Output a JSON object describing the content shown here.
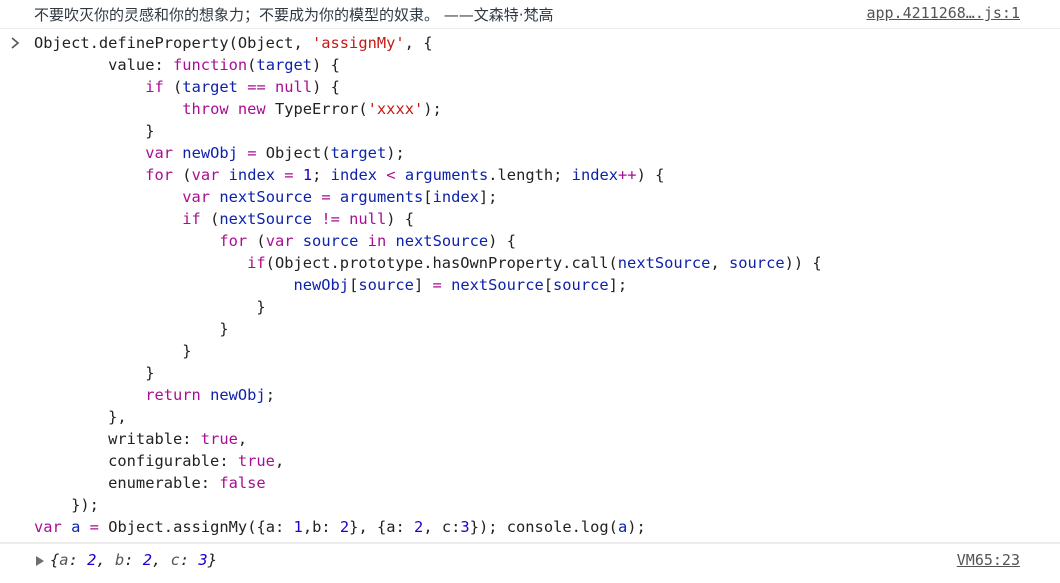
{
  "console_message": {
    "text": "不要吹灭你的灵感和你的想象力；不要成为你的模型的奴隶。 ——文森特·梵高",
    "source": "app.4211268….js:1"
  },
  "input_prompt_icon": "chevron-right-icon",
  "code_lines": [
    [
      [
        "pl",
        "Object.defineProperty(Object, "
      ],
      [
        "str",
        "'assignMy'"
      ],
      [
        "pl",
        ", {"
      ]
    ],
    [
      [
        "pl",
        "        value: "
      ],
      [
        "kw",
        "function"
      ],
      [
        "pl",
        "("
      ],
      [
        "var",
        "target"
      ],
      [
        "pl",
        ") {"
      ]
    ],
    [
      [
        "pl",
        "            "
      ],
      [
        "kw",
        "if"
      ],
      [
        "pl",
        " ("
      ],
      [
        "var",
        "target"
      ],
      [
        "pl",
        " "
      ],
      [
        "kw",
        "=="
      ],
      [
        "pl",
        " "
      ],
      [
        "kw",
        "null"
      ],
      [
        "pl",
        ") {"
      ]
    ],
    [
      [
        "pl",
        "                "
      ],
      [
        "kw",
        "throw"
      ],
      [
        "pl",
        " "
      ],
      [
        "kw",
        "new"
      ],
      [
        "pl",
        " TypeError("
      ],
      [
        "str",
        "'xxxx'"
      ],
      [
        "pl",
        ");"
      ]
    ],
    [
      [
        "pl",
        "            }"
      ]
    ],
    [
      [
        "pl",
        "            "
      ],
      [
        "kw",
        "var"
      ],
      [
        "pl",
        " "
      ],
      [
        "var",
        "newObj"
      ],
      [
        "pl",
        " "
      ],
      [
        "kw",
        "="
      ],
      [
        "pl",
        " Object("
      ],
      [
        "var",
        "target"
      ],
      [
        "pl",
        ");"
      ]
    ],
    [
      [
        "pl",
        "            "
      ],
      [
        "kw",
        "for"
      ],
      [
        "pl",
        " ("
      ],
      [
        "kw",
        "var"
      ],
      [
        "pl",
        " "
      ],
      [
        "var",
        "index"
      ],
      [
        "pl",
        " "
      ],
      [
        "kw",
        "="
      ],
      [
        "pl",
        " "
      ],
      [
        "num",
        "1"
      ],
      [
        "pl",
        "; "
      ],
      [
        "var",
        "index"
      ],
      [
        "pl",
        " "
      ],
      [
        "kw",
        "<"
      ],
      [
        "pl",
        " "
      ],
      [
        "var",
        "arguments"
      ],
      [
        "pl",
        ".length; "
      ],
      [
        "var",
        "index"
      ],
      [
        "kw",
        "++"
      ],
      [
        "pl",
        ") {"
      ]
    ],
    [
      [
        "pl",
        "                "
      ],
      [
        "kw",
        "var"
      ],
      [
        "pl",
        " "
      ],
      [
        "var",
        "nextSource"
      ],
      [
        "pl",
        " "
      ],
      [
        "kw",
        "="
      ],
      [
        "pl",
        " "
      ],
      [
        "var",
        "arguments"
      ],
      [
        "pl",
        "["
      ],
      [
        "var",
        "index"
      ],
      [
        "pl",
        "];"
      ]
    ],
    [
      [
        "pl",
        "                "
      ],
      [
        "kw",
        "if"
      ],
      [
        "pl",
        " ("
      ],
      [
        "var",
        "nextSource"
      ],
      [
        "pl",
        " "
      ],
      [
        "kw",
        "!="
      ],
      [
        "pl",
        " "
      ],
      [
        "kw",
        "null"
      ],
      [
        "pl",
        ") {"
      ]
    ],
    [
      [
        "pl",
        "                    "
      ],
      [
        "kw",
        "for"
      ],
      [
        "pl",
        " ("
      ],
      [
        "kw",
        "var"
      ],
      [
        "pl",
        " "
      ],
      [
        "var",
        "source"
      ],
      [
        "pl",
        " "
      ],
      [
        "kw",
        "in"
      ],
      [
        "pl",
        " "
      ],
      [
        "var",
        "nextSource"
      ],
      [
        "pl",
        ") {"
      ]
    ],
    [
      [
        "pl",
        "                       "
      ],
      [
        "kw",
        "if"
      ],
      [
        "pl",
        "(Object.prototype.hasOwnProperty.call("
      ],
      [
        "var",
        "nextSource"
      ],
      [
        "pl",
        ", "
      ],
      [
        "var",
        "source"
      ],
      [
        "pl",
        ")) {"
      ]
    ],
    [
      [
        "pl",
        "                            "
      ],
      [
        "var",
        "newObj"
      ],
      [
        "pl",
        "["
      ],
      [
        "var",
        "source"
      ],
      [
        "pl",
        "] "
      ],
      [
        "kw",
        "="
      ],
      [
        "pl",
        " "
      ],
      [
        "var",
        "nextSource"
      ],
      [
        "pl",
        "["
      ],
      [
        "var",
        "source"
      ],
      [
        "pl",
        "];"
      ]
    ],
    [
      [
        "pl",
        "                        }"
      ]
    ],
    [
      [
        "pl",
        "                    }"
      ]
    ],
    [
      [
        "pl",
        "                }"
      ]
    ],
    [
      [
        "pl",
        "            }"
      ]
    ],
    [
      [
        "pl",
        "            "
      ],
      [
        "kw",
        "return"
      ],
      [
        "pl",
        " "
      ],
      [
        "var",
        "newObj"
      ],
      [
        "pl",
        ";"
      ]
    ],
    [
      [
        "pl",
        "        },"
      ]
    ],
    [
      [
        "pl",
        "        writable: "
      ],
      [
        "kw",
        "true"
      ],
      [
        "pl",
        ","
      ]
    ],
    [
      [
        "pl",
        "        configurable: "
      ],
      [
        "kw",
        "true"
      ],
      [
        "pl",
        ","
      ]
    ],
    [
      [
        "pl",
        "        enumerable: "
      ],
      [
        "kw",
        "false"
      ]
    ],
    [
      [
        "pl",
        "    });"
      ]
    ],
    [
      [
        "kw",
        "var"
      ],
      [
        "pl",
        " "
      ],
      [
        "var",
        "a"
      ],
      [
        "pl",
        " "
      ],
      [
        "kw",
        "="
      ],
      [
        "pl",
        " Object.assignMy({a: "
      ],
      [
        "num",
        "1"
      ],
      [
        "pl",
        ",b: "
      ],
      [
        "num",
        "2"
      ],
      [
        "pl",
        "}, {a: "
      ],
      [
        "num",
        "2"
      ],
      [
        "pl",
        ", c:"
      ],
      [
        "num",
        "3"
      ],
      [
        "pl",
        "}); console.log("
      ],
      [
        "var",
        "a"
      ],
      [
        "pl",
        ");"
      ]
    ]
  ],
  "result": {
    "expand_icon": "triangle-right-icon",
    "open_brace": "{",
    "entries": [
      {
        "key": "a",
        "value": "2"
      },
      {
        "key": "b",
        "value": "2"
      },
      {
        "key": "c",
        "value": "3"
      }
    ],
    "close_brace": "}",
    "source": "VM65:23"
  },
  "colors": {
    "keyword": "#aa0d91",
    "string": "#c41a16",
    "number": "#1c00cf",
    "variable": "#0d22aa",
    "link": "#545454"
  }
}
